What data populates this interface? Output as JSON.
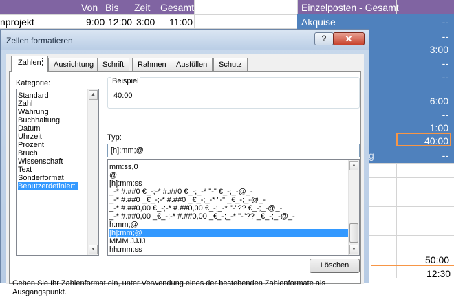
{
  "sheet": {
    "headers": {
      "von": "Von",
      "bis": "Bis",
      "zeit": "Zeit",
      "gesamt": "Gesamt",
      "einzelposten": "Einzelposten - Gesamt"
    },
    "row1": {
      "name": "nprojekt",
      "von": "9:00",
      "bis": "12:00",
      "zeit": "3:00",
      "gesamt": "11:00"
    },
    "blue_cells": {
      "akquise": "Akquise",
      "r1": "--",
      "r2": "--",
      "r3": "3:00",
      "r4": "--",
      "r5": "--",
      "r6": "6:00",
      "r7": "--",
      "r8": "1:00",
      "r9": "40:00",
      "r10": "--",
      "partial": "g"
    },
    "bottom": {
      "v1": "50:00",
      "v2": "12:30"
    },
    "colors": {
      "header": "#8064a2",
      "blue": "#4f81bd",
      "selection": "#f79646"
    }
  },
  "dialog": {
    "title": "Zellen formatieren",
    "help": "?",
    "close": "✕",
    "tabs": [
      "Zahlen",
      "Ausrichtung",
      "Schrift",
      "Rahmen",
      "Ausfüllen",
      "Schutz"
    ],
    "category_label": "Kategorie:",
    "categories": [
      "Standard",
      "Zahl",
      "Währung",
      "Buchhaltung",
      "Datum",
      "Uhrzeit",
      "Prozent",
      "Bruch",
      "Wissenschaft",
      "Text",
      "Sonderformat",
      "Benutzerdefiniert"
    ],
    "example_label": "Beispiel",
    "example_value": "40:00",
    "type_label": "Typ:",
    "type_value": "[h]:mm;@",
    "formats": [
      "mm:ss,0",
      "@",
      "[h]:mm:ss",
      "_-* #.##0 €_-;-* #.##0 €_-;_-* \"-\" €_-;_-@_-",
      "_-* #.##0 _€_-;-* #.##0 _€_-;_-* \"-\" _€_-;_-@_-",
      "_-* #.##0,00 €_-;-* #.##0,00 €_-;_-* \"-\"?? €_-;_-@_-",
      "_-* #.##0,00 _€_-;-* #.##0,00 _€_-;_-* \"-\"?? _€_-;_-@_-",
      "h:mm;@",
      "[h]:mm;@",
      "MMM JJJJ",
      "hh:mm:ss"
    ],
    "delete_label": "Löschen",
    "description": "Geben Sie Ihr Zahlenformat ein, unter Verwendung eines der bestehenden Zahlenformate als Ausgangspunkt."
  }
}
